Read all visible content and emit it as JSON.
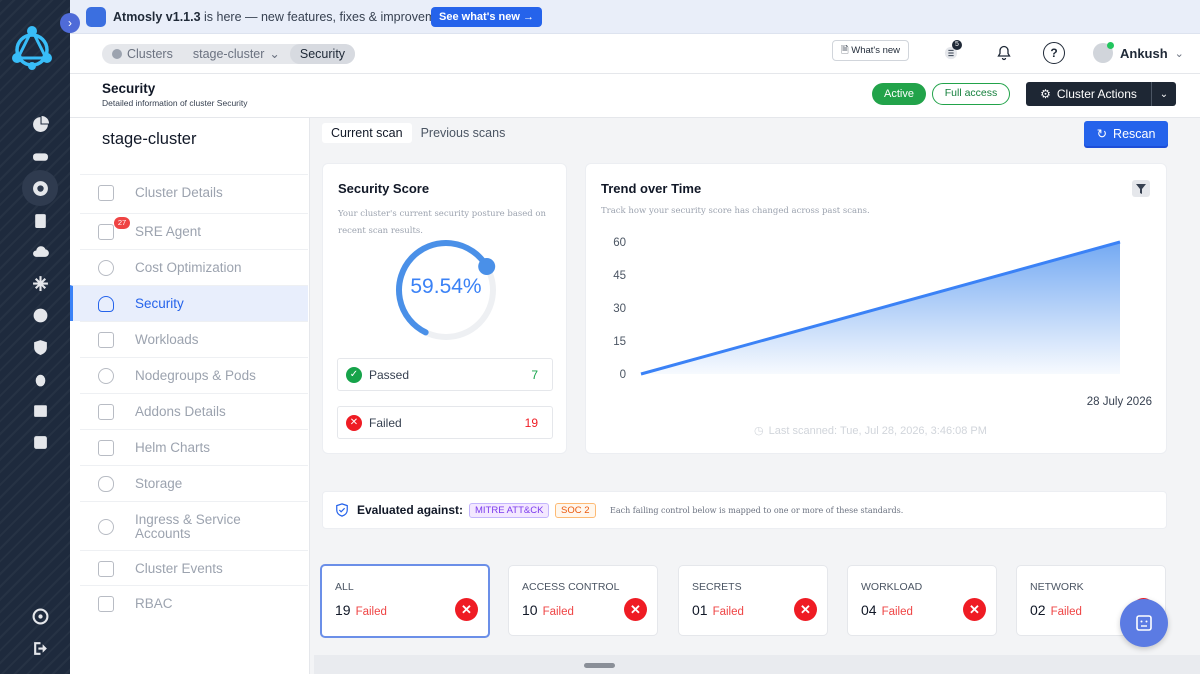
{
  "announcement": {
    "version": "Atmosly v1.1.3",
    "text": " is here — new features, fixes & improvements.",
    "button": "See what's new  →"
  },
  "breadcrumbs": [
    "Clusters",
    "stage-cluster",
    "Security"
  ],
  "topbar": {
    "whats_new": "What's new",
    "notification_count": "5",
    "help": "?",
    "user": "Ankush"
  },
  "page": {
    "title": "Security",
    "subtitle": "Detailed information of cluster Security",
    "status_active": "Active",
    "status_access": "Full access",
    "cluster_actions": "Cluster Actions"
  },
  "sidebar": {
    "cluster_name": "stage-cluster",
    "items": [
      {
        "label": "Cluster Details"
      },
      {
        "label": "SRE Agent",
        "badge": "27"
      },
      {
        "label": "Cost Optimization"
      },
      {
        "label": "Security"
      },
      {
        "label": "Workloads"
      },
      {
        "label": "Nodegroups & Pods"
      },
      {
        "label": "Addons Details"
      },
      {
        "label": "Helm Charts"
      },
      {
        "label": "Storage"
      },
      {
        "label": "Ingress & Service Accounts"
      },
      {
        "label": "Cluster Events"
      },
      {
        "label": "RBAC"
      }
    ]
  },
  "tabs": [
    "Current scan",
    "Previous scans"
  ],
  "rescan_label": "Rescan",
  "score": {
    "title": "Security Score",
    "description": "Your cluster's current security posture based on recent scan results.",
    "value_text": "59.54%",
    "value": 59.54,
    "passed_label": "Passed",
    "passed": "7",
    "failed_label": "Failed",
    "failed": "19"
  },
  "trend": {
    "title": "Trend over Time",
    "description": "Track how your security score has changed across past scans.",
    "last_scanned": "Last scanned: Tue, Jul 28, 2026, 3:46:08 PM"
  },
  "chart_data": {
    "type": "area",
    "title": "Trend over Time",
    "y_ticks": [
      "60",
      "45",
      "30",
      "15",
      "0"
    ],
    "ylim": [
      0,
      60
    ],
    "x_labels": [
      "28 July 2026"
    ],
    "series": [
      {
        "values": [
          0,
          60
        ]
      }
    ],
    "grid": false,
    "color": "#5b9af0"
  },
  "evaluation": {
    "label": "Evaluated against:",
    "standards": [
      "MITRE ATT&CK",
      "SOC 2"
    ],
    "note": "Each failing control below is mapped to one or more of these standards."
  },
  "categories": [
    {
      "name": "ALL",
      "count": "19",
      "status": "Failed"
    },
    {
      "name": "ACCESS CONTROL",
      "count": "10",
      "status": "Failed"
    },
    {
      "name": "SECRETS",
      "count": "01",
      "status": "Failed"
    },
    {
      "name": "WORKLOAD",
      "count": "04",
      "status": "Failed"
    },
    {
      "name": "NETWORK",
      "count": "02",
      "status": "Failed"
    }
  ],
  "colors": {
    "accent": "#2563eb",
    "success": "#22a34a",
    "danger": "#ef1c24",
    "rail": "#1e2a3d"
  },
  "icons": {
    "rail": [
      "dashboard-icon",
      "gamepad-icon",
      "kubernetes-icon",
      "clipboard-icon",
      "cloud-upload-icon",
      "asterisk-icon",
      "helm-icon",
      "shield-icon",
      "bug-icon",
      "package-icon",
      "server-icon",
      "settings-icon",
      "logout-icon"
    ]
  }
}
